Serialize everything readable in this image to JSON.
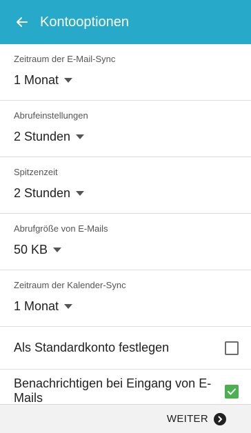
{
  "appbar": {
    "title": "Kontooptionen",
    "back_icon": "arrow-left-icon",
    "color": "#27a9c9"
  },
  "settings": [
    {
      "label": "Zeitraum der E-Mail-Sync",
      "value": "1 Monat"
    },
    {
      "label": "Abrufeinstellungen",
      "value": "2 Stunden"
    },
    {
      "label": "Spitzenzeit",
      "value": "2 Stunden"
    },
    {
      "label": "Abrufgröße von E-Mails",
      "value": "50 KB"
    },
    {
      "label": "Zeitraum der Kalender-Sync",
      "value": "1 Monat"
    }
  ],
  "checkboxes": [
    {
      "label": "Als Standardkonto festlegen",
      "checked": false
    },
    {
      "label": "Benachrichtigen bei Eingang von E-Mails",
      "checked": true,
      "check_color": "#4caf50"
    }
  ],
  "footer": {
    "next_label": "WEITER",
    "next_icon": "chevron-right-circle-icon"
  }
}
